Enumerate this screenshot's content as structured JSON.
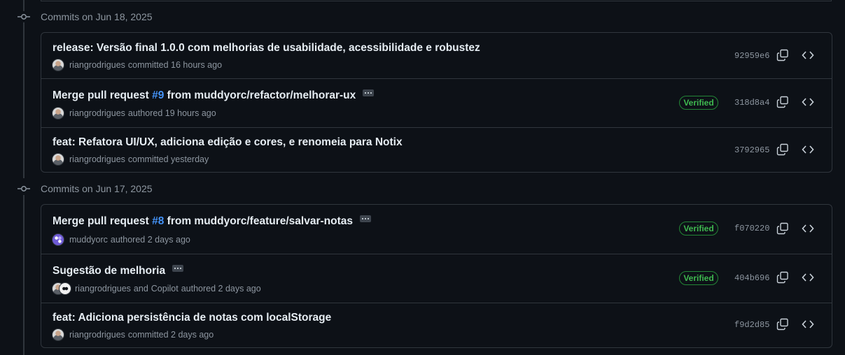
{
  "groups": [
    {
      "title": "Commits on Jun 18, 2025",
      "commits": [
        {
          "title": "release: Versão final 1.0.0 com melhorias de usabilidade, acessibilidade e robustez",
          "author": "riangrodrigues",
          "action": "committed 16 hours ago",
          "sha": "92959e6",
          "verified": ""
        },
        {
          "title_prefix": "Merge pull request ",
          "pr": "#9",
          "title_suffix": " from muddyorc/refactor/melhorar-ux",
          "author": "riangrodrigues",
          "action": "authored 19 hours ago",
          "sha": "318d8a4",
          "verified": "Verified"
        },
        {
          "title": "feat: Refatora UI/UX, adiciona edição e cores, e renomeia para Notix",
          "author": "riangrodrigues",
          "action": "committed yesterday",
          "sha": "3792965",
          "verified": ""
        }
      ]
    },
    {
      "title": "Commits on Jun 17, 2025",
      "commits": [
        {
          "title_prefix": "Merge pull request ",
          "pr": "#8",
          "title_suffix": " from muddyorc/feature/salvar-notas",
          "author": "muddyorc",
          "action": "authored 2 days ago",
          "sha": "f070220",
          "verified": "Verified"
        },
        {
          "title": "Sugestão de melhoria",
          "author": "riangrodrigues",
          "coauthor_join": "and",
          "coauthor": "Copilot",
          "action": "authored 2 days ago",
          "sha": "404b696",
          "verified": "Verified"
        },
        {
          "title": "feat: Adiciona persistência de notas com localStorage",
          "author": "riangrodrigues",
          "action": "committed 2 days ago",
          "sha": "f9d2d85",
          "verified": ""
        }
      ]
    }
  ],
  "icons": {
    "commit": "git-commit-icon",
    "copy": "copy-icon",
    "browse": "code-icon",
    "ellipsis": "kebab-horizontal-icon"
  },
  "colors": {
    "background": "#0d1117",
    "border": "#30363d",
    "link": "#4493f8",
    "verified": "#3fb950",
    "muted": "#8d96a0"
  }
}
